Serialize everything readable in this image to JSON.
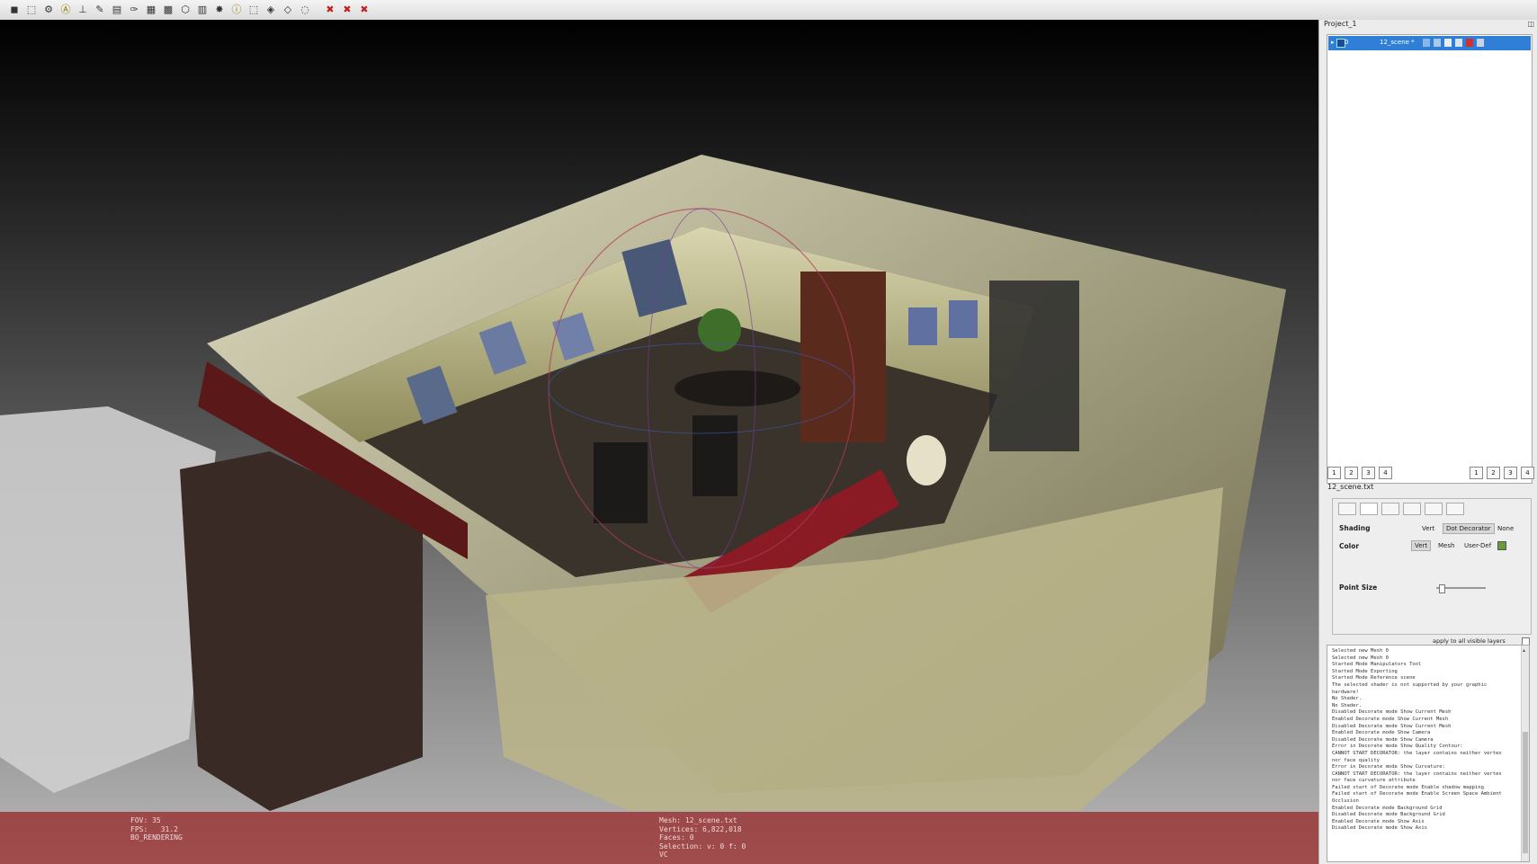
{
  "toolbar": {
    "icons": [
      "open-icon",
      "save-icon",
      "settings-icon",
      "annotate-icon",
      "axes-icon",
      "brush-icon",
      "print-icon",
      "paint-icon",
      "texture-icon",
      "grid-icon",
      "wireframe-icon",
      "chart-icon",
      "star-icon",
      "info-icon",
      "select-icon",
      "select-faces-icon",
      "select-verts-icon",
      "select-connected-icon",
      "delete-icon",
      "delete-faces-icon",
      "delete-verts-icon"
    ]
  },
  "viewport": {
    "stats_left": {
      "fov": "FOV: 35",
      "fps": "FPS:   31.2",
      "mode": "BO_RENDERING"
    },
    "stats_right": {
      "mesh": "Mesh: 12_scene.txt",
      "vertices": "Vertices: 6,822,018",
      "faces": "Faces: 0",
      "selection": "Selection: v: 0 f: 0",
      "vc": "VC"
    }
  },
  "panel": {
    "project_title": "Project_1",
    "layer": {
      "index": "0",
      "name": "12_scene *"
    },
    "view_buttons_left": [
      "1",
      "2",
      "3",
      "4"
    ],
    "view_buttons_right": [
      "1",
      "2",
      "3",
      "4"
    ],
    "file_name": "12_scene.txt",
    "shading": {
      "label": "Shading",
      "options": [
        "Vert",
        "Dot Decorator",
        "None"
      ],
      "selected": "Dot Decorator"
    },
    "color": {
      "label": "Color",
      "options": [
        "Vert",
        "Mesh",
        "User-Def"
      ],
      "selected": "Vert",
      "swatch": "#6a9a3a"
    },
    "point_size": {
      "label": "Point Size",
      "value": 0.05
    },
    "apply_all": "apply to all visible layers",
    "log": [
      "Selected new Mesh 0",
      "Selected new Mesh 0",
      "Started Mode Manipulators Tool",
      "Started Mode Exporting",
      "Started Mode Reference scene",
      "The selected shader is not supported by your graphic",
      "hardware!",
      "No Shader.",
      "No Shader.",
      "Disabled Decorate mode Show Current Mesh",
      "Enabled Decorate mode Show Current Mesh",
      "Disabled Decorate mode Show Current Mesh",
      "Enabled Decorate mode Show Camera",
      "Disabled Decorate mode Show Camera",
      "Error in Decorate mode Show Quality Contour:",
      "CANNOT START DECORATOR: the layer contains neither vertex",
      "nor face quality",
      "Error in Decorate mode Show Curvature:",
      "CANNOT START DECORATOR: the layer contains neither vertex",
      "nor face curvature attribute",
      "Failed start of Decorate mode Enable shadow mapping",
      "Failed start of Decorate mode Enable Screen Space Ambient",
      "Occlusion",
      "Enabled Decorate mode Background Grid",
      "Disabled Decorate mode Background Grid",
      "Enabled Decorate mode Show Axis",
      "Disabled Decorate mode Show Axis"
    ]
  }
}
